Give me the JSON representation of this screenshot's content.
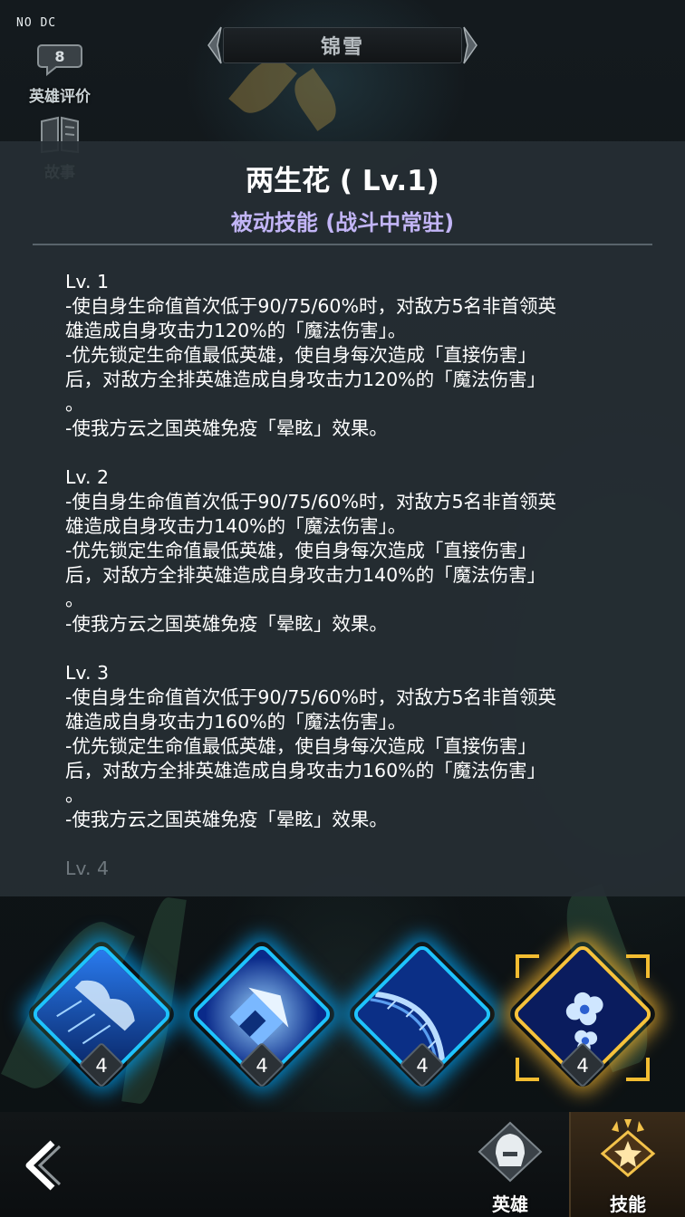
{
  "debug_label": "NO DC",
  "side_buttons": {
    "hero_rating": "英雄评价",
    "story": "故事"
  },
  "hero_name": "锦雪",
  "skill_panel": {
    "title": "两生花 ( Lv.1)",
    "type": "被动技能 (战斗中常驻)",
    "levels": [
      {
        "title": "Lv. 1",
        "lines": [
          "-使自身生命值首次低于90/75/60%时，对敌方5名非首领英",
          "雄造成自身攻击力120%的「魔法伤害」。",
          "-优先锁定生命值最低英雄，使自身每次造成「直接伤害」",
          "后，对敌方全排英雄造成自身攻击力120%的「魔法伤害」",
          "。",
          "-使我方云之国英雄免疫「晕眩」效果。"
        ]
      },
      {
        "title": "Lv. 2",
        "lines": [
          "-使自身生命值首次低于90/75/60%时，对敌方5名非首领英",
          "雄造成自身攻击力140%的「魔法伤害」。",
          "-优先锁定生命值最低英雄，使自身每次造成「直接伤害」",
          "后，对敌方全排英雄造成自身攻击力140%的「魔法伤害」",
          "。",
          "-使我方云之国英雄免疫「晕眩」效果。"
        ]
      },
      {
        "title": "Lv. 3",
        "lines": [
          "-使自身生命值首次低于90/75/60%时，对敌方5名非首领英",
          "雄造成自身攻击力160%的「魔法伤害」。",
          "-优先锁定生命值最低英雄，使自身每次造成「直接伤害」",
          "后，对敌方全排英雄造成自身攻击力160%的「魔法伤害」",
          "。",
          "-使我方云之国英雄免疫「晕眩」效果。"
        ]
      }
    ],
    "next_level_peek": "Lv. 4"
  },
  "skills": [
    {
      "icon": "storm-cloud-skill-icon",
      "level": "4",
      "selected": false
    },
    {
      "icon": "pavilion-skill-icon",
      "level": "4",
      "selected": false
    },
    {
      "icon": "bridge-skill-icon",
      "level": "4",
      "selected": false
    },
    {
      "icon": "twin-flower-skill-icon",
      "level": "4",
      "selected": true
    }
  ],
  "bottom_nav": {
    "hero_tab": "英雄",
    "skill_tab": "技能",
    "active": "skill"
  },
  "colors": {
    "skill_type": "#c2b5f6",
    "skill_border": "#1ec3ff",
    "selected_border": "#f6c23c",
    "panel_bg": "#262e34"
  }
}
